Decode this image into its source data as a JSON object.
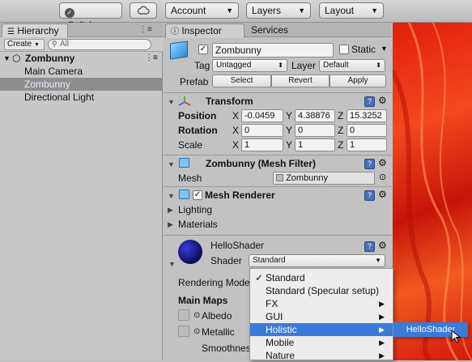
{
  "toolbar": {
    "collab": "Collab",
    "account": "Account",
    "layers": "Layers",
    "layout": "Layout"
  },
  "hierarchy": {
    "tab": "Hierarchy",
    "create": "Create",
    "search_placeholder": "All",
    "scene": "Zombunny",
    "items": [
      "Main Camera",
      "Zombunny",
      "Directional Light"
    ]
  },
  "inspector": {
    "tab": "Inspector",
    "services_tab": "Services",
    "object_name": "Zombunny",
    "static_label": "Static",
    "tag_label": "Tag",
    "tag_value": "Untagged",
    "layer_label": "Layer",
    "layer_value": "Default",
    "prefab_label": "Prefab",
    "prefab_buttons": [
      "Select",
      "Revert",
      "Apply"
    ],
    "transform": {
      "title": "Transform",
      "position_label": "Position",
      "rotation_label": "Rotation",
      "scale_label": "Scale",
      "axes": [
        "X",
        "Y",
        "Z"
      ],
      "position": [
        "-0.0459",
        "4.38876",
        "15.3252"
      ],
      "rotation": [
        "0",
        "0",
        "0"
      ],
      "scale": [
        "1",
        "1",
        "1"
      ]
    },
    "mesh_filter": {
      "title": "Zombunny (Mesh Filter)",
      "mesh_label": "Mesh",
      "mesh_value": "Zombunny"
    },
    "mesh_renderer": {
      "title": "Mesh Renderer",
      "lighting": "Lighting",
      "materials": "Materials"
    },
    "material": {
      "name": "HelloShader",
      "shader_label": "Shader",
      "shader_value": "Standard",
      "rendering_mode": "Rendering Mode",
      "main_maps": "Main Maps",
      "albedo": "Albedo",
      "metallic": "Metallic",
      "smoothness": "Smoothness"
    }
  },
  "shader_menu": {
    "items": [
      {
        "label": "Standard",
        "checked": true,
        "submenu": false
      },
      {
        "label": "Standard (Specular setup)",
        "checked": false,
        "submenu": false
      },
      {
        "label": "FX",
        "checked": false,
        "submenu": true
      },
      {
        "label": "GUI",
        "checked": false,
        "submenu": true
      },
      {
        "label": "Holistic",
        "checked": false,
        "submenu": true,
        "highlighted": true
      },
      {
        "label": "Mobile",
        "checked": false,
        "submenu": true
      },
      {
        "label": "Nature",
        "checked": false,
        "submenu": true
      }
    ],
    "submenu_item": "HelloShader"
  },
  "colors": {
    "selection": "#8e8e8e",
    "menu_highlight": "#3a7ad8",
    "help_icon": "#4b6fb3",
    "desktop_red": "#e01e0e"
  }
}
